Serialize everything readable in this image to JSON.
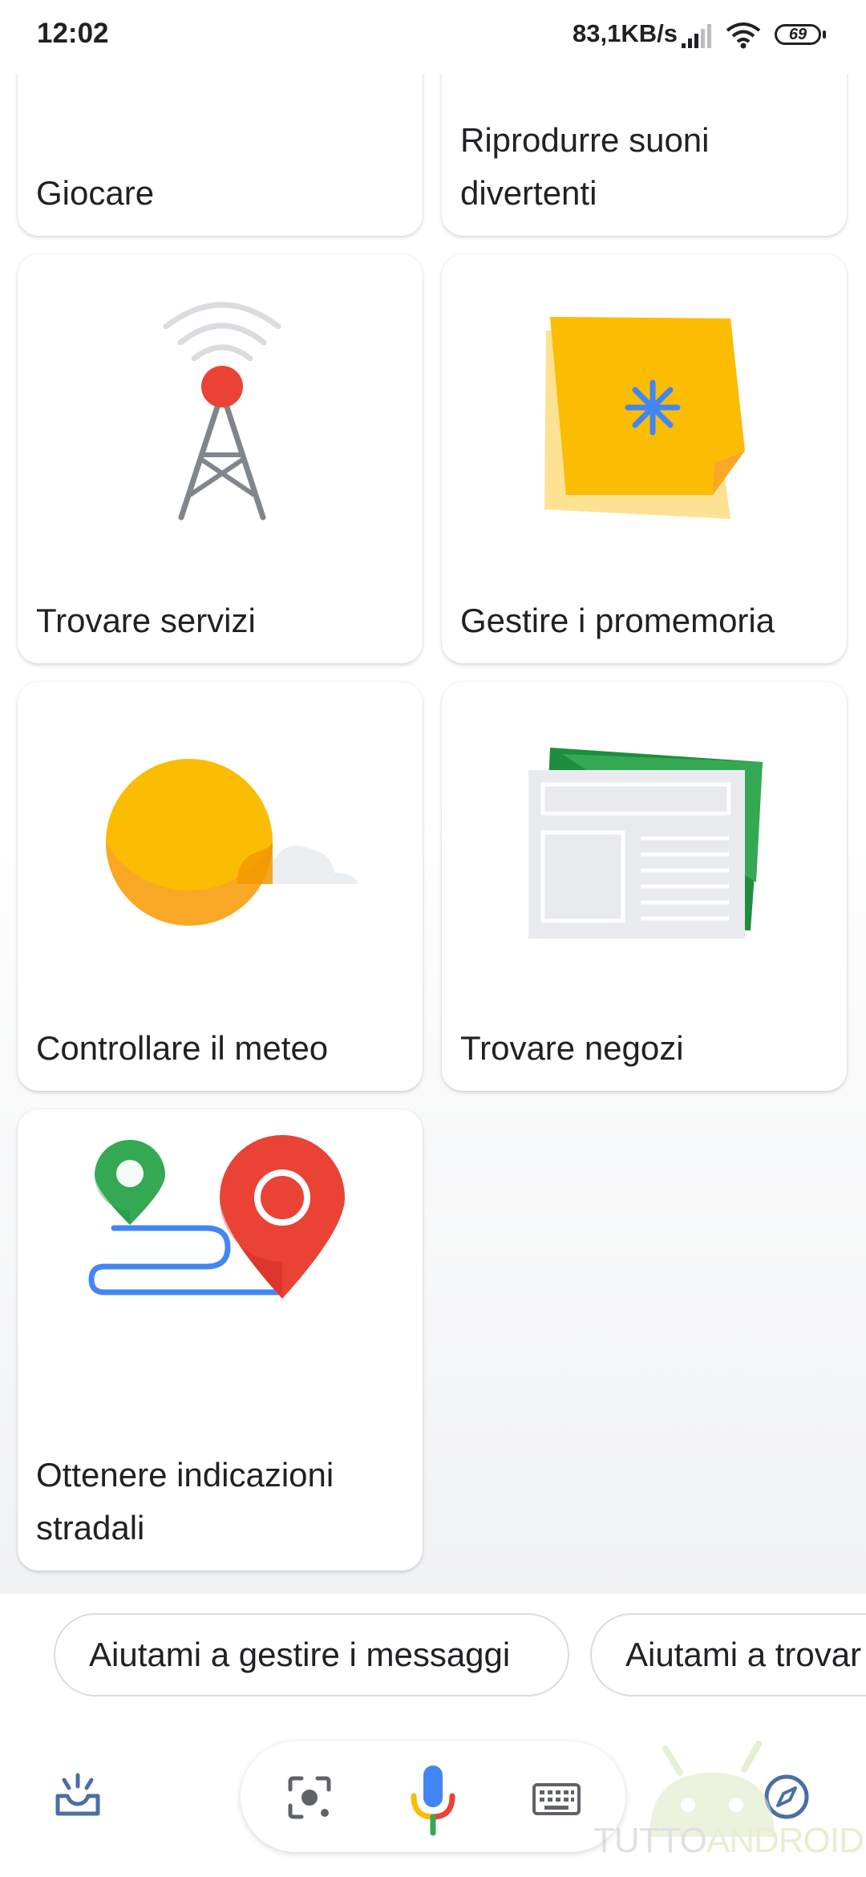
{
  "status_bar": {
    "time": "12:02",
    "net_speed": "83,1KB/s",
    "battery": "69"
  },
  "cards": [
    {
      "label": "Giocare",
      "icon": "game-icon"
    },
    {
      "label": "Riprodurre suoni divertenti",
      "icon": "sounds-icon"
    },
    {
      "label": "Trovare servizi",
      "icon": "radio-tower-icon"
    },
    {
      "label": "Gestire i promemoria",
      "icon": "sticky-note-reminder-icon"
    },
    {
      "label": "Controllare il meteo",
      "icon": "sun-cloud-weather-icon"
    },
    {
      "label": "Trovare negozi",
      "icon": "newspaper-icon"
    },
    {
      "label": "Ottenere indicazioni stradali",
      "icon": "map-route-pins-icon"
    }
  ],
  "suggestion_chips": [
    {
      "label": "Aiutami a gestire i messaggi"
    },
    {
      "label": "Aiutami a trovar"
    }
  ],
  "bottom_bar": {
    "left_icon": "updates-tray-icon",
    "lens_icon": "lens-icon",
    "mic_icon": "microphone-icon",
    "keyboard_icon": "keyboard-icon",
    "explore_icon": "compass-icon"
  },
  "watermark": {
    "text_a": "TUTTO",
    "text_b": "ANDROID"
  },
  "colors": {
    "accent_blue": "#4285f4",
    "accent_red": "#ea4335",
    "accent_yellow": "#fbbc04",
    "accent_green": "#34a853"
  }
}
